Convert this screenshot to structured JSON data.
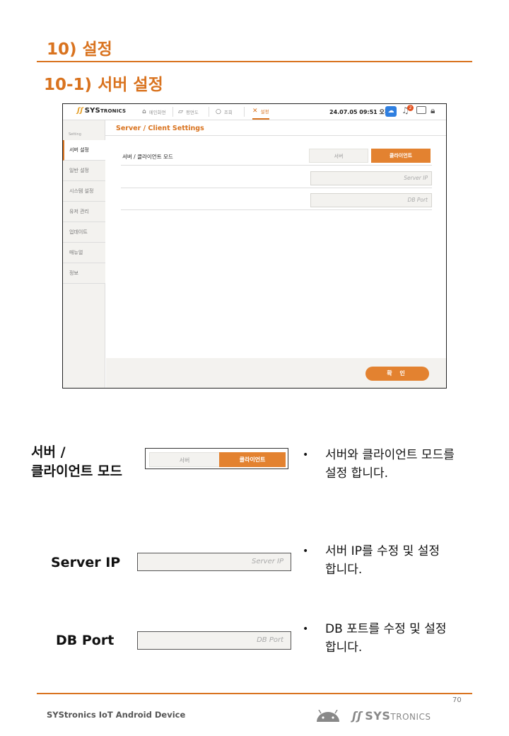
{
  "heading1": "10) 설정",
  "heading2": "10-1)  서버 설정",
  "screen": {
    "logo": {
      "mark": "ʃʃ",
      "sys": "SYS",
      "tronics": "TRONICS"
    },
    "nav": [
      {
        "label": "메인화면",
        "icon": "home-icon"
      },
      {
        "label": "평면도",
        "icon": "map-icon"
      },
      {
        "label": "조회",
        "icon": "search-icon"
      },
      {
        "label": "설정",
        "icon": "tools-icon",
        "active": true
      }
    ],
    "datetime": "24.07.05 09:51 오전",
    "notification_count": "2",
    "sidebar": {
      "heading": "Setting",
      "items": [
        "서버 설정",
        "일반 설정",
        "시스템 설정",
        "유저 관리",
        "업데이트",
        "매뉴얼",
        "정보"
      ],
      "active_index": 0
    },
    "content_title": "Server / Client Settings",
    "mode_label": "서버 / 클라이언트 모드",
    "mode_options": [
      "서버",
      "클라이언트"
    ],
    "selected_mode": "클라이언트",
    "server_ip_placeholder": "Server IP",
    "db_port_placeholder": "DB Port",
    "confirm_label": "확 인",
    "colors": {
      "accent": "#e38230",
      "heading": "#d9731f",
      "panel": "#f3f2ef"
    }
  },
  "explanations": [
    {
      "label_line1": "서버 /",
      "label_line2": "클라이언트 모드",
      "options": [
        "서버",
        "클라이언트"
      ],
      "desc_line1": "서버와 클라이언트 모드를",
      "desc_line2": "설정 합니다."
    },
    {
      "label": "Server IP",
      "placeholder": "Server IP",
      "desc_line1": "서버 IP를 수정 및 설정",
      "desc_line2": "합니다."
    },
    {
      "label": "DB Port",
      "placeholder": "DB Port",
      "desc_line1": "DB 포트를 수정 및 설정",
      "desc_line2": "합니다."
    }
  ],
  "bullet_char": "•",
  "footer": {
    "page_number": "70",
    "left_text": "SYStronics IoT Android Device",
    "logo_mark": "ʃʃ",
    "logo_sys": "SYS",
    "logo_tronics": "TRONICS"
  }
}
